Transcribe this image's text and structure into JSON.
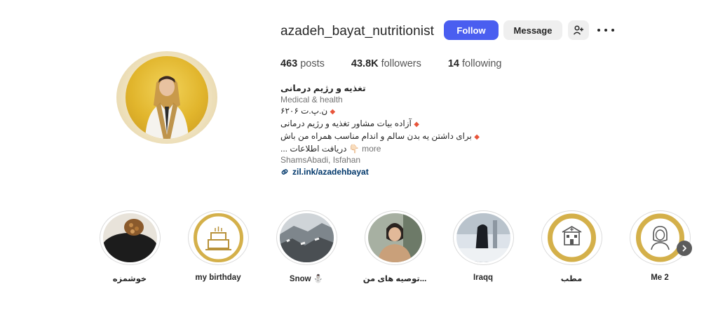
{
  "profile": {
    "username": "azadeh_bayat_nutritionist",
    "follow_label": "Follow",
    "message_label": "Message",
    "stats": {
      "posts_count": "463",
      "posts_label": "posts",
      "followers_count": "43.8K",
      "followers_label": "followers",
      "following_count": "14",
      "following_label": "following"
    },
    "bio": {
      "full_name": "تغذیه و رژیم درمانی",
      "category": "Medical & health",
      "line1": "ن.پ.ت ۶۲۰۶",
      "line2": "آزاده بیات مشاور تغذیه و رژیم درمانی",
      "line3": "برای داشتن یه بدن سالم و اندام مناسب همراه من باش",
      "line4": "👇🏻 دریافت اطلاعات ...",
      "more_label": "more",
      "location": "ShamsAbadi, Isfahan",
      "link": "zil.ink/azadehbayat"
    }
  },
  "highlights": [
    {
      "label": "خوشمزه"
    },
    {
      "label": "my birthday"
    },
    {
      "label": "Snow ⛄"
    },
    {
      "label": "توصیه های من..."
    },
    {
      "label": "Iraqq"
    },
    {
      "label": "مطب"
    },
    {
      "label": "Me 2"
    }
  ],
  "colors": {
    "follow_button": "#4a5ef0",
    "secondary_button": "#efefef",
    "link": "#00376b",
    "bullet": "#e8543a",
    "gold": "#d4b04a"
  }
}
